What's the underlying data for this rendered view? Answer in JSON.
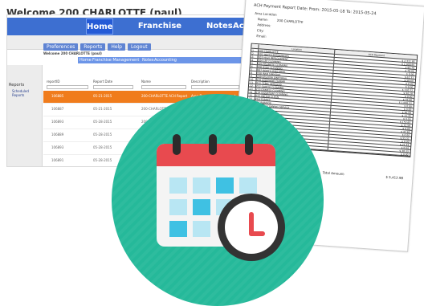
{
  "welcome_text": "Welcome 200 CHARLOTTE (paul)",
  "top_nav": {
    "tabs": [
      "Home",
      "Franchise Management",
      "Notes",
      "Accou"
    ]
  },
  "toolbar": {
    "buttons": [
      "Preferences",
      "Reports",
      "Help",
      "Logout"
    ]
  },
  "sub_welcome": "Welcome 200 CHARLOTTE (paul)",
  "inner_nav": [
    "Home",
    "Franchise Management",
    "Notes",
    "Accounting"
  ],
  "reports_panel": {
    "title": "Reports",
    "item": "Scheduled Reports"
  },
  "grid": {
    "columns": [
      "reportID",
      "Report Date",
      "Name",
      "Description"
    ],
    "rows": [
      {
        "id": "106885",
        "date": "05-21-2015",
        "name": "200-CHARLOTTE ACH Report",
        "desc": "Area Developer ACH Report",
        "selected": true
      },
      {
        "id": "106887",
        "date": "05-21-2015",
        "name": "200-CHARLOTTE Invoice Report",
        "desc": "",
        "selected": false
      },
      {
        "id": "106893",
        "date": "05-28-2015",
        "name": "200-CHARLOTTE",
        "desc": "",
        "selected": false
      },
      {
        "id": "106889",
        "date": "05-28-2015",
        "name": "200-CHARLOTTE",
        "desc": "",
        "selected": false
      },
      {
        "id": "106893",
        "date": "05-28-2015",
        "name": "",
        "desc": "",
        "selected": false
      },
      {
        "id": "106891",
        "date": "05-28-2015",
        "name": "",
        "desc": "",
        "selected": false
      }
    ]
  },
  "pager": [
    "<",
    "1",
    "2",
    ">"
  ],
  "report": {
    "title": "ACH Payment Report  Date:  From: 2015-05-18 To: 2015-05-24",
    "area_location": "Area Location",
    "name_label": "Name:",
    "name_value": "200 CHARLOTTE",
    "address_label": "Address:",
    "city_label": "City:",
    "email_label": "Email:",
    "columns": [
      "Location",
      "ACH Payment"
    ],
    "rows": [
      {
        "n": "1",
        "loc": "200 CHARLOTTE",
        "amt": "$ 2,311.85"
      },
      {
        "n": "2",
        "loc": "201 WATTS ENTERPRISES",
        "amt": "$ 1,000.95"
      },
      {
        "n": "3",
        "loc": "203 HIGH IMPROVEMENT",
        "amt": "$ 83.79"
      },
      {
        "n": "4",
        "loc": "204 LEE CLEANING",
        "amt": "$ 78.00"
      },
      {
        "n": "5",
        "loc": "205 PROMPTE CLEANING",
        "amt": "$ 0.00"
      },
      {
        "n": "6",
        "loc": "206 BYRD CLEANING",
        "amt": "$ 62.31"
      },
      {
        "n": "7",
        "loc": "207 REED'S JANITORIAL",
        "amt": "$ 58.68"
      },
      {
        "n": "8",
        "loc": "208 IRAN SIMMONS",
        "amt": "$ 0.00"
      },
      {
        "n": "9",
        "loc": "209 SEGOVIA JANITORIAL",
        "amt": "$ 0.00"
      },
      {
        "n": "10",
        "loc": "210 JOSEPHINE FARRAR",
        "amt": "$ 120.72"
      },
      {
        "n": "11",
        "loc": "211 TEBEL SERVICES",
        "amt": "$ 90.28"
      },
      {
        "n": "12",
        "loc": "212 GARCIA CLEANING",
        "amt": "$ 0.00"
      },
      {
        "n": "13",
        "loc": "213 DANIELS CLEANING",
        "amt": "$ 55.80"
      },
      {
        "n": "14",
        "loc": "214 SIGNATURE CLEANING",
        "amt": "$ 1,046.51"
      },
      {
        "n": "15",
        "loc": "215 UNITED CLEAN",
        "amt": "$ 0.00"
      },
      {
        "n": "16",
        "loc": "216 TORRES",
        "amt": "$ 0.00"
      },
      {
        "n": "17",
        "loc": "217 BARRIOS",
        "amt": "$ 46.08"
      },
      {
        "n": "18",
        "loc": "218 B&B CLEANING SERVICE",
        "amt": "$ 11.35"
      },
      {
        "n": "19",
        "loc": "219 HOWELL",
        "amt": "$ 0.00"
      },
      {
        "n": "20",
        "loc": "220 SPARKLE",
        "amt": "$ 153.60"
      },
      {
        "n": "21",
        "loc": "221 SLADE",
        "amt": "$ 72.58"
      },
      {
        "n": "22",
        "loc": "222 RICHARDSON",
        "amt": "$ 0.00"
      },
      {
        "n": "23",
        "loc": "223 NGUYEN",
        "amt": "$ 42.64"
      },
      {
        "n": "24",
        "loc": "224 MARTIN",
        "amt": "$ 0.00"
      },
      {
        "n": "25",
        "loc": "225 ORTIZ",
        "amt": "$ 55.51"
      },
      {
        "n": "26",
        "loc": "226 WILLIAMS",
        "amt": "$ 0.00"
      },
      {
        "n": "27",
        "loc": "227 SANDERS",
        "amt": "$ 21.44"
      },
      {
        "n": "28",
        "loc": "228 PARKER",
        "amt": "$ 0.00"
      },
      {
        "n": "29",
        "loc": "229 LOPEZ",
        "amt": "$ 38.33"
      },
      {
        "n": "30",
        "loc": "230 JOHNSON",
        "amt": "$ 0.00"
      }
    ],
    "total_label": "Total Amount:",
    "total_value": "$ 5,412.98"
  },
  "colors": {
    "accent_blue": "#3d6fd1",
    "selected_row": "#f07c1c",
    "icon_circle": "#25b99a",
    "calendar_red": "#e84a4f",
    "calendar_cell_blue": "#3fc1e3",
    "clock_face": "#ffffff",
    "clock_rim": "#333333"
  },
  "icons": [
    "calendar-icon",
    "clock-icon"
  ]
}
